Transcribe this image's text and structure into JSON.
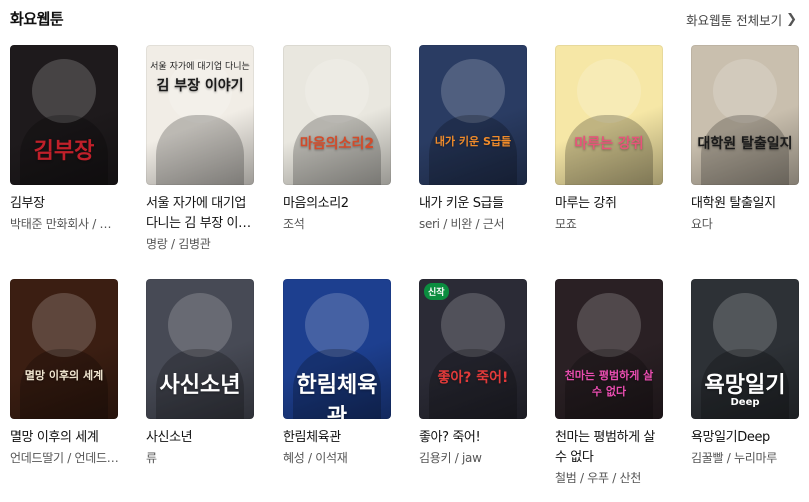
{
  "header": {
    "title": "화요웹툰",
    "more_label": "화요웹툰 전체보기",
    "more_icon": "chevron-right-icon"
  },
  "rows": [
    [
      {
        "title": "김부장",
        "author": "박태준 만화회사 / 정종택",
        "cover_text": "김부장",
        "bg": "#1e1a1c",
        "accent": "#c0202a"
      },
      {
        "title": "서울 자가에 대기업 다니는 김 부장 이야기",
        "author": "명랑 / 김병관",
        "cover_text": "김 부장 이야기",
        "cover_sub": "서울 자가에 대기업 다니는",
        "bg": "#f1ede6",
        "accent": "#1a1a1a"
      },
      {
        "title": "마음의소리2",
        "author": "조석",
        "cover_text": "마음의소리2",
        "bg": "#e9e7df",
        "accent": "#d24b2a"
      },
      {
        "title": "내가 키운 S급들",
        "author": "seri / 비완 / 근서",
        "cover_text": "내가 키운 S급들",
        "bg": "#2a3c63",
        "accent": "#f08b2a"
      },
      {
        "title": "마루는 강쥐",
        "author": "모죠",
        "cover_text": "마루는 강쥐",
        "bg": "#f6e7a6",
        "accent": "#e6547a"
      },
      {
        "title": "대학원 탈출일지",
        "author": "요다",
        "cover_text": "대학원 탈출일지",
        "bg": "#c9bfae",
        "accent": "#1a1a1a"
      }
    ],
    [
      {
        "title": "멸망 이후의 세계",
        "author": "언데드딸기 / 언데드감자",
        "cover_text": "멸망 이후의 세계",
        "bg": "#3b1e12",
        "accent": "#f0e6d0"
      },
      {
        "title": "사신소년",
        "author": "류",
        "cover_text": "사신소년",
        "bg": "#474a55",
        "accent": "#ffffff"
      },
      {
        "title": "한림체육관",
        "author": "혜성 / 이석재",
        "cover_text": "한림체육관",
        "bg": "#1d3f8f",
        "accent": "#ffffff"
      },
      {
        "title": "좋아? 죽어!",
        "author": "김용키 / jaw",
        "cover_text": "좋아? 죽어!",
        "badge": "신작",
        "bg": "#2b2b36",
        "accent": "#e23a3a"
      },
      {
        "title": "천마는 평범하게 살 수 없다",
        "author": "철범 / 우푸 / 산천",
        "cover_text": "천마는 평범하게 살 수 없다",
        "bg": "#2a2024",
        "accent": "#e94db0"
      },
      {
        "title": "욕망일기Deep",
        "author": "김꿀빨 / 누리마루",
        "cover_text": "욕망일기",
        "cover_sub": "Deep",
        "bg": "#2d3136",
        "accent": "#ffffff"
      }
    ]
  ]
}
